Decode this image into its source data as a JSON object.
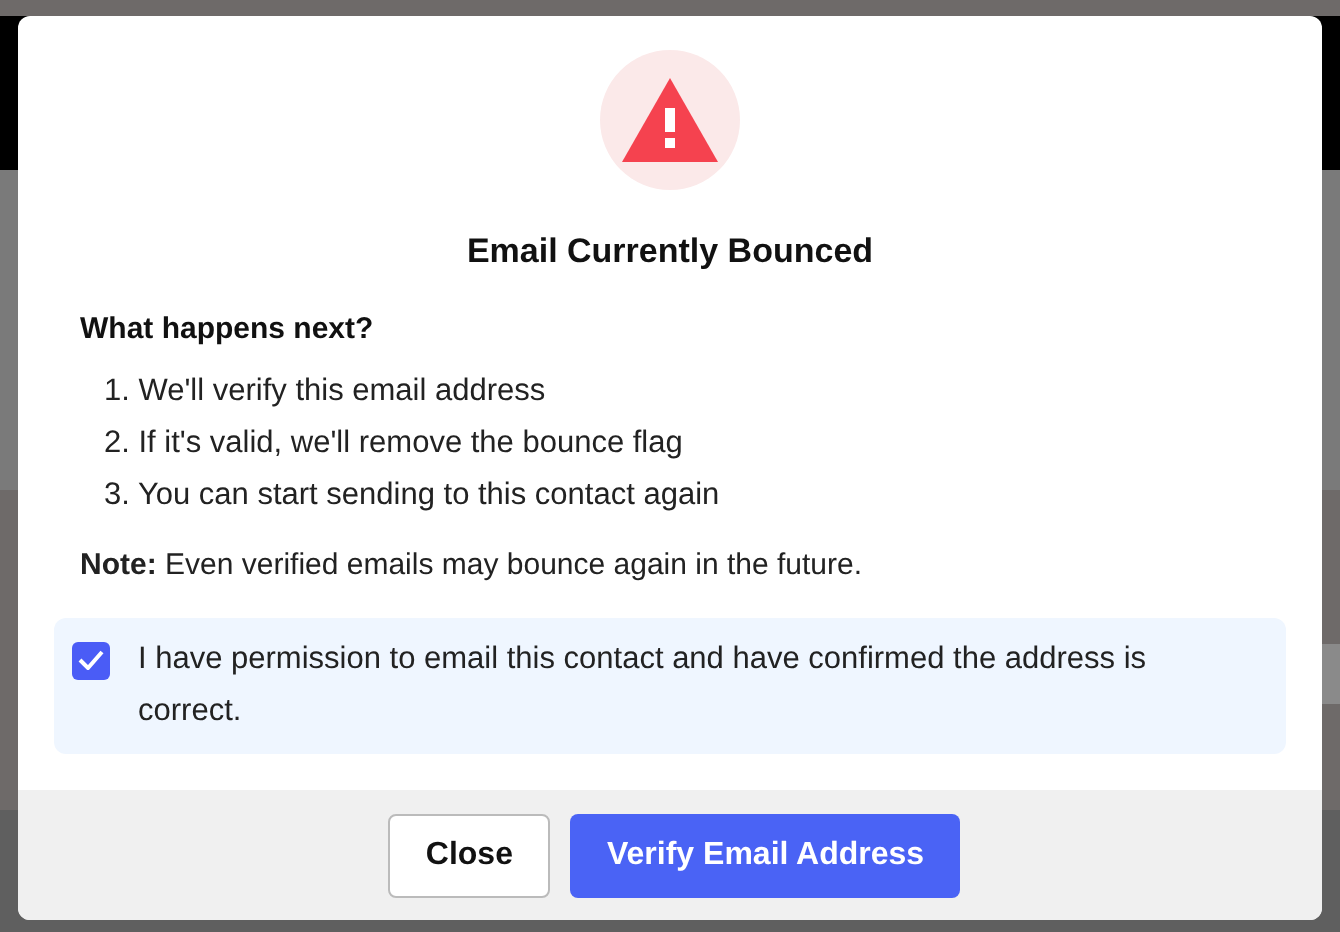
{
  "dialog": {
    "title": "Email Currently Bounced",
    "section_heading": "What happens next?",
    "steps": [
      "1. We'll verify this email address",
      "2. If it's valid, we'll remove the bounce flag",
      "3. You can start sending to this contact again"
    ],
    "note": "**Note:** Even verified emails may bounce again in the future.",
    "confirmation": {
      "label": "I have permission to email this contact and have confirmed the address is correct.",
      "checked": true
    },
    "buttons": [
      {
        "label": "Close",
        "kind": "secondary"
      },
      {
        "label": "Verify Email Address",
        "kind": "primary"
      }
    ]
  }
}
